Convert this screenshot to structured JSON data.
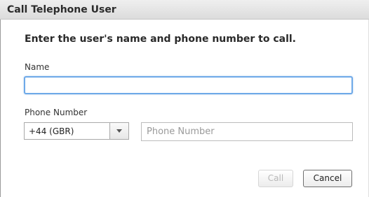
{
  "dialog": {
    "title": "Call Telephone User",
    "instruction": "Enter the user's name and phone number to call."
  },
  "name_field": {
    "label": "Name",
    "value": "",
    "placeholder": ""
  },
  "phone_field": {
    "label": "Phone Number",
    "country_code": "+44 (GBR)",
    "value": "",
    "placeholder": "Phone Number"
  },
  "buttons": {
    "call": "Call",
    "call_enabled": false,
    "cancel": "Cancel"
  },
  "icons": {
    "country_dropdown": "chevron-down-icon"
  },
  "colors": {
    "focus_border": "#6ea9e8",
    "titlebar_bg": "#e4e4e4",
    "disabled_text": "#b8b8b8"
  }
}
